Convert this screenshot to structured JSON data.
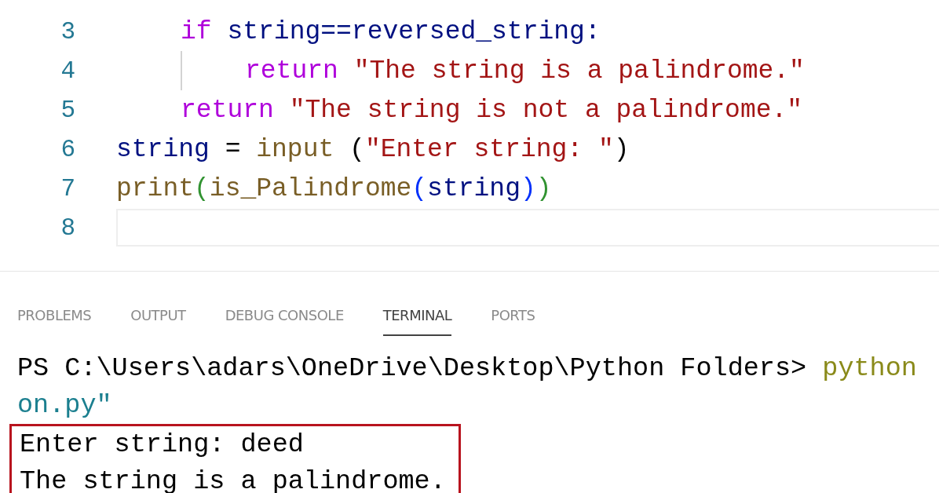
{
  "editor": {
    "lines": [
      {
        "children": [
          {
            "number": "3",
            "current": false,
            "tokens": [
              {
                "text": "if",
                "kind": "keyword"
              },
              {
                "text": " string==reversed_string:",
                "kind": "variable"
              }
            ],
            "children": [
              {
                "number": "4",
                "current": false,
                "tokens": [
                  {
                    "text": "return",
                    "kind": "keyword"
                  },
                  {
                    "text": " \"The string is a palindrome.\"",
                    "kind": "string"
                  }
                ]
              }
            ]
          },
          {
            "number": "5",
            "current": false,
            "tokens": [
              {
                "text": "return",
                "kind": "keyword"
              },
              {
                "text": " \"The string is not a palindrome.\"",
                "kind": "string"
              }
            ]
          }
        ]
      },
      {
        "number": "6",
        "current": false,
        "tokens": [
          {
            "text": "string",
            "kind": "variable"
          },
          {
            "text": " = ",
            "kind": "plain"
          },
          {
            "text": "input",
            "kind": "function"
          },
          {
            "text": " (",
            "kind": "plain"
          },
          {
            "text": "\"Enter string: \"",
            "kind": "string"
          },
          {
            "text": ")",
            "kind": "plain"
          }
        ]
      },
      {
        "number": "7",
        "current": false,
        "tokens": [
          {
            "text": "print",
            "kind": "function"
          },
          {
            "text": "(",
            "kind": "bracket"
          },
          {
            "text": "is_Palindrome",
            "kind": "function"
          },
          {
            "text": "(",
            "kind": "bracket2"
          },
          {
            "text": "string",
            "kind": "variable"
          },
          {
            "text": ")",
            "kind": "bracket2"
          },
          {
            "text": ")",
            "kind": "bracket"
          }
        ]
      },
      {
        "number": "8",
        "current": true
      }
    ]
  },
  "panel": {
    "tabs": [
      {
        "label": "PROBLEMS",
        "selected": false
      },
      {
        "label": "OUTPUT",
        "selected": false
      },
      {
        "label": "DEBUG CONSOLE",
        "selected": false
      },
      {
        "label": "TERMINAL",
        "selected": true
      },
      {
        "label": "PORTS",
        "selected": false
      }
    ],
    "terminal": {
      "blocks": [
        {
          "highlighted": false,
          "lines": [
            [
              {
                "text": "PS C:\\Users\\adars\\OneDrive\\Desktop\\Python Folders> ",
                "kind": "plain"
              },
              {
                "text": "python",
                "kind": "command"
              }
            ],
            [
              {
                "text": "on.py\"",
                "kind": "path"
              }
            ]
          ]
        },
        {
          "highlighted": true,
          "lines": [
            [
              {
                "text": "Enter string: deed",
                "kind": "plain"
              }
            ],
            [
              {
                "text": "The string is a palindrome.",
                "kind": "plain"
              }
            ]
          ]
        }
      ]
    }
  }
}
